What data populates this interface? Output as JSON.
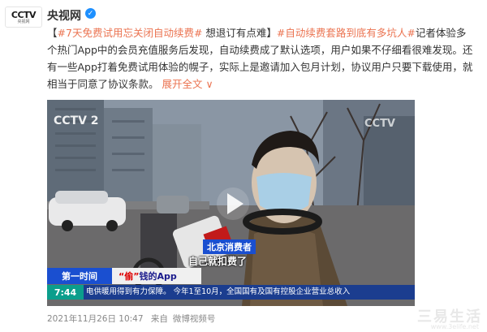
{
  "post": {
    "author": "央视网",
    "avatar_logo": "CCTV",
    "avatar_sub": "央视网",
    "verified_icon": "verified-check-icon",
    "tag1": "#7天免费试用忘关闭自动续费#",
    "text1": " 想退订有点难】",
    "tag2": "#自动续费套路到底有多坑人#",
    "text2": "记者体验多个热门App中的会员充值服务后发现，自动续费成了默认选项，用户如果不仔细看很难发现。还有一些App打着免费试用体验的幌子，实际上是邀请加入包月计划，协议用户只要下载使用，就相当于同意了协议条款。",
    "more_label": "展开全文",
    "more_arrow": "∨",
    "timestamp": "2021年11月26日 10:47",
    "source_prefix": "来自",
    "source": "微博视频号"
  },
  "video": {
    "channel_logo": "CCTV 2",
    "channel_logo_right": "CCTV",
    "caption_who": "北京消费者",
    "caption_quote": "自己就扣费了",
    "program": "第一时间",
    "subject_q": "“偷”",
    "subject": "钱的App",
    "ticker_time": "7:44",
    "ticker_text": "电供暖用得到有力保障。  今年1至10月，全国国有及国有控股企业营业总收入"
  },
  "watermark": {
    "text": "三易生活",
    "sub": "www.3elife.net"
  }
}
